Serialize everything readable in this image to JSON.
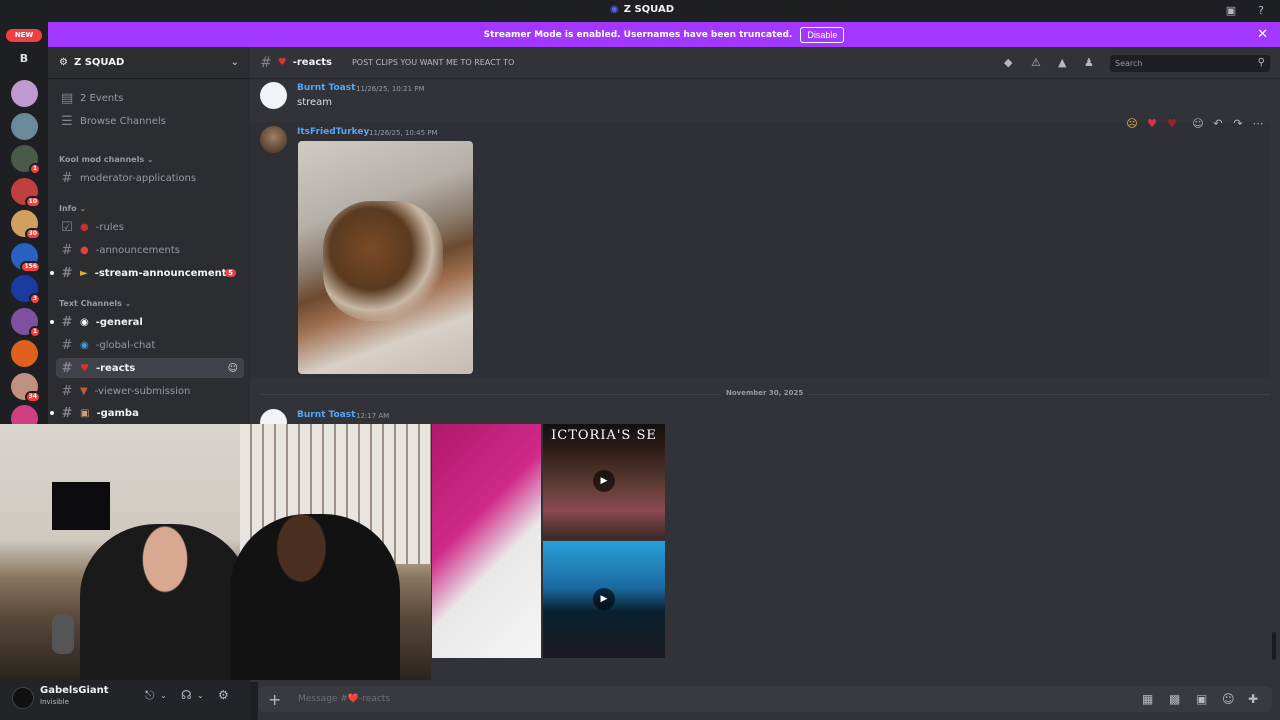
{
  "window": {
    "title": "Z SQUAD"
  },
  "banner": {
    "text": "Streamer Mode is enabled. Usernames have been truncated.",
    "disable_label": "Disable"
  },
  "servers": {
    "new_label": "NEW",
    "b_label": "B",
    "items": [
      {
        "color": "#c09ad0",
        "count": ""
      },
      {
        "color": "#6a8a9a",
        "count": ""
      },
      {
        "color": "#4a5a4a",
        "count": "1"
      },
      {
        "color": "#c04040",
        "count": "10"
      },
      {
        "color": "#d0a060",
        "count": "30"
      },
      {
        "color": "#2a60c0",
        "count": "156"
      },
      {
        "color": "#1a3aa0",
        "count": "3"
      },
      {
        "color": "#8050a0",
        "count": "1"
      },
      {
        "color": "#e06020",
        "count": ""
      },
      {
        "color": "#c09080",
        "count": "34"
      },
      {
        "color": "#d04080",
        "count": ""
      }
    ]
  },
  "sidebar": {
    "guild_name": "Z SQUAD",
    "events": "2 Events",
    "browse": "Browse Channels",
    "cat_kool": "Kool mod channels",
    "cat_info": "Info",
    "cat_text": "Text Channels",
    "channels": {
      "moderator": "moderator-applications",
      "rules": "-rules",
      "announcements": "-announcements",
      "stream_ann": "-stream-announcements",
      "stream_ann_mentions": "5",
      "general": "-general",
      "global_chat": "-global-chat",
      "reacts": "-reacts",
      "viewer_sub": "-viewer-submission",
      "gamba": "-gamba"
    }
  },
  "channel_header": {
    "name": "-reacts",
    "topic": "POST CLIPS YOU WANT ME TO REACT TO",
    "search_placeholder": "Search"
  },
  "messages": [
    {
      "author": "Burnt Toast",
      "timestamp": "11/26/25, 10:21 PM",
      "text": "stream"
    },
    {
      "author": "ItsFriedTurkey",
      "timestamp": "11/26/25, 10:45 PM"
    },
    {
      "author": "Burnt Toast",
      "timestamp": "12:17 AM"
    }
  ],
  "date_divider": "November 30, 2025",
  "video_brand": "ICTORIA'S SE",
  "composer": {
    "placeholder": "Message #❤️-reacts"
  },
  "user": {
    "name": "GabelsGiant",
    "status": "Invisible"
  },
  "icons": [
    "discord-logo-icon",
    "screen-share-icon",
    "help-icon",
    "calendar-icon",
    "hash-icon",
    "threads-icon",
    "bell-icon",
    "pin-icon",
    "members-icon",
    "search-icon",
    "mic-icon",
    "headphones-icon",
    "gear-icon",
    "gift-icon",
    "gif-icon",
    "sticker-icon",
    "emoji-icon",
    "apps-icon",
    "play-icon"
  ]
}
